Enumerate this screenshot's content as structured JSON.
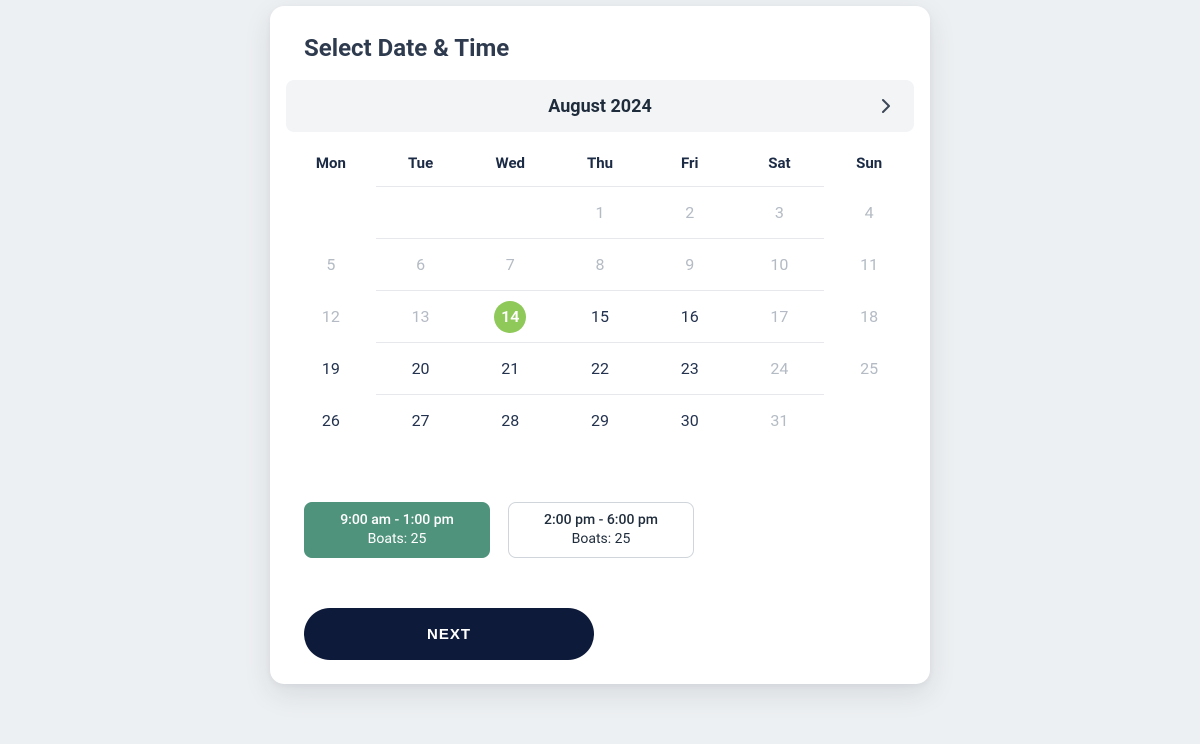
{
  "title": "Select Date & Time",
  "calendar": {
    "month_label": "August 2024",
    "dow": [
      "Mon",
      "Tue",
      "Wed",
      "Thu",
      "Fri",
      "Sat",
      "Sun"
    ],
    "weeks": [
      [
        {
          "n": null
        },
        {
          "n": null
        },
        {
          "n": null
        },
        {
          "n": "1",
          "state": "disabled"
        },
        {
          "n": "2",
          "state": "disabled"
        },
        {
          "n": "3",
          "state": "weekend-disabled"
        },
        {
          "n": "4",
          "state": "weekend-disabled"
        }
      ],
      [
        {
          "n": "5",
          "state": "disabled"
        },
        {
          "n": "6",
          "state": "disabled"
        },
        {
          "n": "7",
          "state": "disabled"
        },
        {
          "n": "8",
          "state": "disabled"
        },
        {
          "n": "9",
          "state": "disabled"
        },
        {
          "n": "10",
          "state": "weekend-disabled"
        },
        {
          "n": "11",
          "state": "weekend-disabled"
        }
      ],
      [
        {
          "n": "12",
          "state": "disabled"
        },
        {
          "n": "13",
          "state": "disabled"
        },
        {
          "n": "14",
          "state": "selected"
        },
        {
          "n": "15",
          "state": "enabled"
        },
        {
          "n": "16",
          "state": "enabled"
        },
        {
          "n": "17",
          "state": "weekend-disabled"
        },
        {
          "n": "18",
          "state": "weekend-disabled"
        }
      ],
      [
        {
          "n": "19",
          "state": "enabled"
        },
        {
          "n": "20",
          "state": "enabled"
        },
        {
          "n": "21",
          "state": "enabled"
        },
        {
          "n": "22",
          "state": "enabled"
        },
        {
          "n": "23",
          "state": "enabled"
        },
        {
          "n": "24",
          "state": "weekend-disabled"
        },
        {
          "n": "25",
          "state": "weekend-disabled"
        }
      ],
      [
        {
          "n": "26",
          "state": "enabled"
        },
        {
          "n": "27",
          "state": "enabled"
        },
        {
          "n": "28",
          "state": "enabled"
        },
        {
          "n": "29",
          "state": "enabled"
        },
        {
          "n": "30",
          "state": "enabled"
        },
        {
          "n": "31",
          "state": "weekend-disabled"
        },
        {
          "n": null
        }
      ]
    ]
  },
  "slots": [
    {
      "time": "9:00 am - 1:00 pm",
      "boats_label": "Boats: 25",
      "selected": true
    },
    {
      "time": "2:00 pm - 6:00 pm",
      "boats_label": "Boats: 25",
      "selected": false
    }
  ],
  "next_label": "NEXT"
}
